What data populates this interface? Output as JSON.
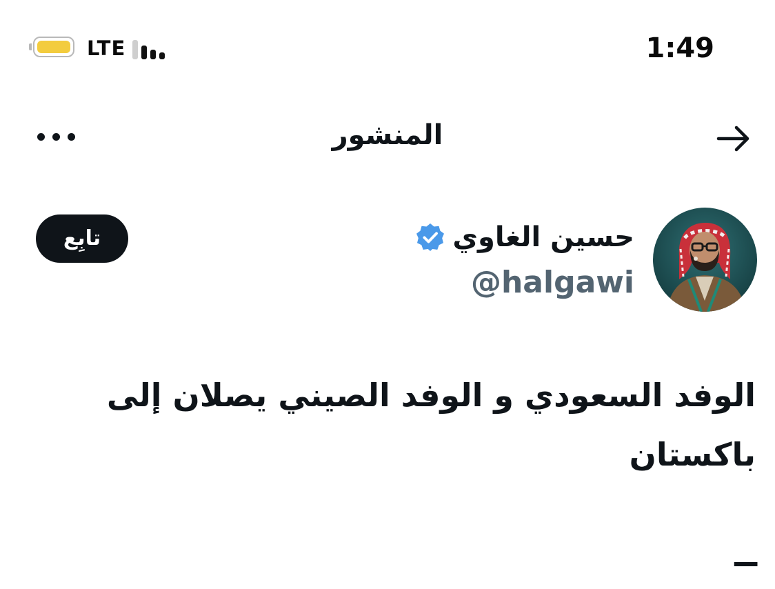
{
  "status_bar": {
    "network": "LTE",
    "time": "1:49",
    "battery_color": "#f3cc3e",
    "signal_bars_active": 4
  },
  "nav": {
    "title": "المنشور",
    "more_icon": "more-horizontal-icon",
    "back_icon": "arrow-right-icon"
  },
  "profile": {
    "display_name": "حسين الغاوي",
    "handle": "@halgawi",
    "verified_icon": "verified-badge-icon",
    "verified_color": "#4a99e9",
    "follow_label": "تابِع"
  },
  "tweet": {
    "text": "الوفد السعودي و الوفد الصيني يصلان إلى باكستان",
    "trailing": "ــ"
  }
}
